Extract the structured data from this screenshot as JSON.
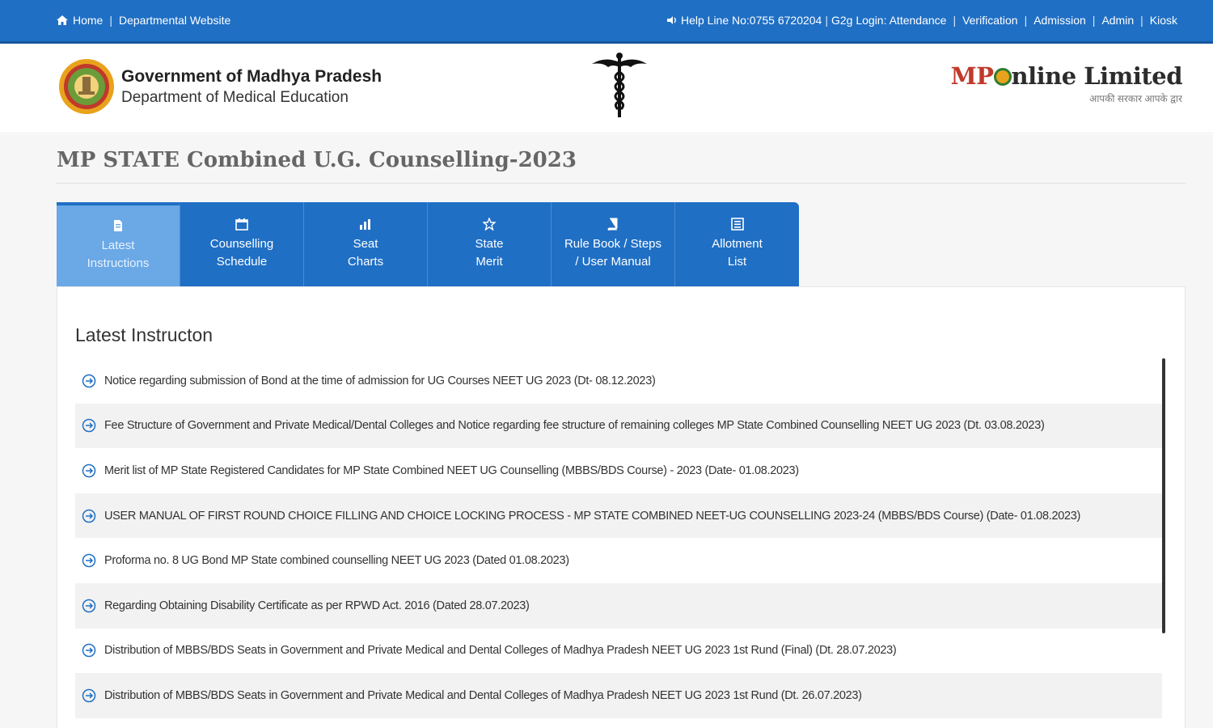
{
  "topbar": {
    "home": "Home",
    "departmental": "Departmental Website",
    "helpline": "Help Line No:0755 6720204",
    "g2g": "G2g Login: Attendance",
    "verification": "Verification",
    "admission": "Admission",
    "admin": "Admin",
    "kiosk": "Kiosk"
  },
  "header": {
    "gov_title": "Government of Madhya Pradesh",
    "gov_sub": "Department of Medical Education",
    "brand_mp": "MP",
    "brand_rest": "nline Limited",
    "tagline": "आपकी सरकार आपके द्वार"
  },
  "page_title": "MP STATE Combined U.G. Counselling-2023",
  "tabs": [
    {
      "line1": "Latest",
      "line2": "Instructions",
      "icon": "document-icon"
    },
    {
      "line1": "Counselling",
      "line2": "Schedule",
      "icon": "calendar-icon"
    },
    {
      "line1": "Seat",
      "line2": "Charts",
      "icon": "chart-icon"
    },
    {
      "line1": "State",
      "line2": "Merit",
      "icon": "star-icon"
    },
    {
      "line1": "Rule Book / Steps",
      "line2": "/ User Manual",
      "icon": "book-icon"
    },
    {
      "line1": "Allotment",
      "line2": "List",
      "icon": "list-icon"
    }
  ],
  "panel_heading": "Latest Instructon",
  "items": [
    "Notice regarding submission of Bond at the time of admission for UG Courses NEET UG 2023 (Dt- 08.12.2023)",
    "Fee Structure of Government and Private Medical/Dental Colleges and Notice regarding fee structure of remaining colleges MP State Combined Counselling NEET UG 2023 (Dt. 03.08.2023)",
    "Merit list of MP State Registered Candidates for MP State Combined NEET UG Counselling (MBBS/BDS Course) - 2023 (Date- 01.08.2023)",
    "USER MANUAL OF FIRST ROUND CHOICE FILLING AND CHOICE LOCKING PROCESS - MP STATE COMBINED NEET-UG COUNSELLING 2023-24 (MBBS/BDS Course) (Date- 01.08.2023)",
    "Proforma no. 8 UG Bond MP State combined counselling NEET UG 2023 (Dated 01.08.2023)",
    "Regarding Obtaining Disability Certificate as per RPWD Act. 2016 (Dated 28.07.2023)",
    "Distribution of MBBS/BDS Seats in Government and Private Medical and Dental Colleges of Madhya Pradesh NEET UG 2023 1st Rund (Final) (Dt. 28.07.2023)",
    "Distribution of MBBS/BDS Seats in Government and Private Medical and Dental Colleges of Madhya Pradesh NEET UG 2023 1st Rund (Dt. 26.07.2023)"
  ],
  "colors": {
    "primary": "#1f6fc5",
    "active_tab": "#6aa8e6",
    "brand_red": "#c0392b"
  }
}
